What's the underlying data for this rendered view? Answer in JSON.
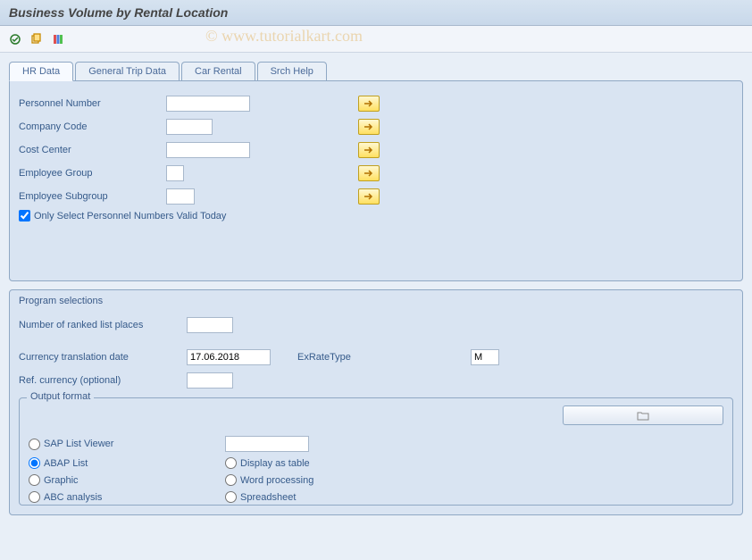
{
  "title": "Business Volume by Rental Location",
  "watermark": "© www.tutorialkart.com",
  "tabs": [
    {
      "label": "HR Data",
      "active": true
    },
    {
      "label": "General Trip Data",
      "active": false
    },
    {
      "label": "Car Rental",
      "active": false
    },
    {
      "label": "Srch Help",
      "active": false
    }
  ],
  "hr": {
    "personnel_number_label": "Personnel Number",
    "personnel_number": "",
    "company_code_label": "Company Code",
    "company_code": "",
    "cost_center_label": "Cost Center",
    "cost_center": "",
    "emp_group_label": "Employee Group",
    "emp_group": "",
    "emp_subgroup_label": "Employee Subgroup",
    "emp_subgroup": "",
    "only_valid_label": "Only Select Personnel Numbers Valid Today",
    "only_valid_checked": true
  },
  "program_selections": {
    "title": "Program selections",
    "ranked_label": "Number of ranked list places",
    "ranked": "",
    "currency_date_label": "Currency translation date",
    "currency_date": "17.06.2018",
    "exrate_label": "ExRateType",
    "exrate": "M",
    "ref_currency_label": "Ref. currency (optional)",
    "ref_currency": ""
  },
  "output_format": {
    "title": "Output format",
    "layout_value": "",
    "options": {
      "sap_list": "SAP List Viewer",
      "abap_list": "ABAP List",
      "graphic": "Graphic",
      "abc": "ABC analysis",
      "display_table": "Display as table",
      "word": "Word processing",
      "spreadsheet": "Spreadsheet"
    },
    "selected": "abap_list"
  }
}
